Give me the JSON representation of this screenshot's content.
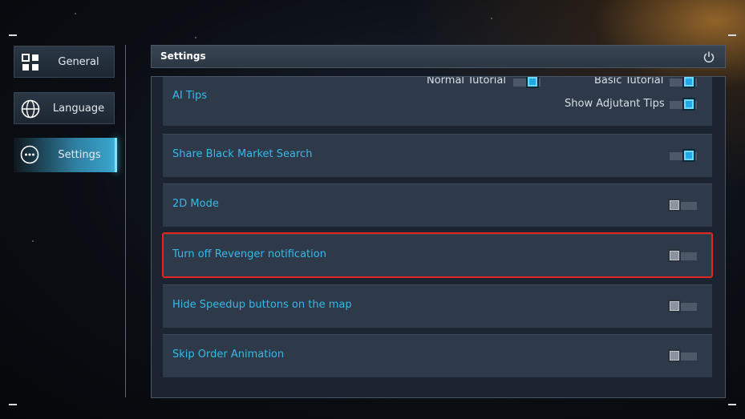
{
  "sidebar": {
    "items": [
      {
        "label": "General",
        "icon": "grid-icon"
      },
      {
        "label": "Language",
        "icon": "globe-icon"
      },
      {
        "label": "Settings",
        "icon": "more-dots-icon",
        "active": true
      }
    ]
  },
  "panel": {
    "title": "Settings",
    "power_icon": "power-icon"
  },
  "rows": [
    {
      "label": "AI Tips",
      "sub": [
        {
          "label": "Normal Tutorial",
          "state": "on"
        },
        {
          "label": "Basic Tutorial",
          "state": "on"
        },
        {
          "label": "Show Adjutant Tips",
          "state": "on"
        }
      ]
    },
    {
      "label": "Share Black Market Search",
      "state": "on"
    },
    {
      "label": "2D Mode",
      "state": "off"
    },
    {
      "label": "Turn off Revenger notification",
      "state": "off",
      "highlighted": true
    },
    {
      "label": "Hide Speedup buttons on the map",
      "state": "off"
    },
    {
      "label": "Skip Order Animation",
      "state": "off"
    }
  ],
  "colors": {
    "accent": "#35b9e8",
    "toggle_on": "#1fa9e6",
    "highlight": "#e0261e"
  }
}
